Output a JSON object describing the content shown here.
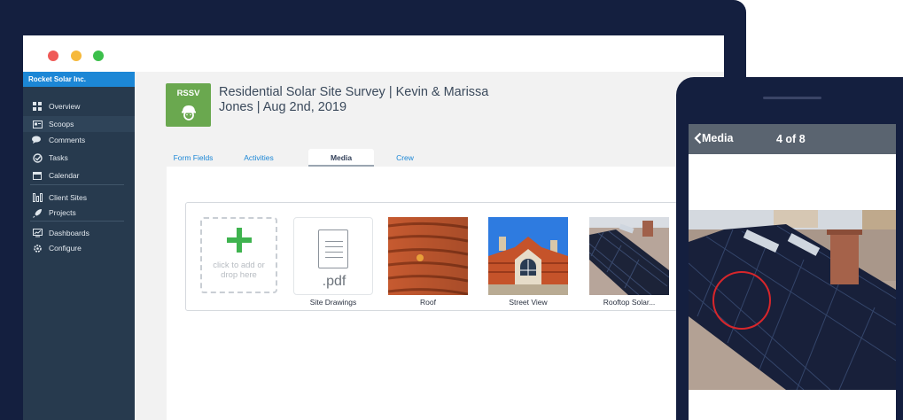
{
  "app": {
    "brand": "Rocket Solar Inc.",
    "nav": [
      {
        "label": "Overview",
        "icon": "grid-icon"
      },
      {
        "label": "Scoops",
        "icon": "scoop-card-icon"
      },
      {
        "label": "Comments",
        "icon": "comments-icon"
      },
      {
        "label": "Tasks",
        "icon": "tasks-icon"
      },
      {
        "label": "Calendar",
        "icon": "calendar-icon"
      },
      {
        "label": "Client Sites",
        "icon": "client-sites-icon"
      },
      {
        "label": "Projects",
        "icon": "rocket-icon"
      },
      {
        "label": "Dashboards",
        "icon": "dashboard-icon"
      },
      {
        "label": "Configure",
        "icon": "gear-icon"
      }
    ]
  },
  "scoop": {
    "badge": "RSSV",
    "title": "Residential Solar Site Survey | Kevin & Marissa Jones | Aug 2nd, 2019"
  },
  "tabs": [
    {
      "label": "Form Fields"
    },
    {
      "label": "Activities"
    },
    {
      "label": "Media",
      "active": true
    },
    {
      "label": "Crew"
    }
  ],
  "media": {
    "dropzone_text": "click to add or drop here",
    "items": [
      {
        "caption": "Site Drawings",
        "type": "pdf",
        "ext": ".pdf"
      },
      {
        "caption": "Roof",
        "type": "image"
      },
      {
        "caption": "Street View",
        "type": "image"
      },
      {
        "caption": "Rooftop Solar...",
        "type": "image"
      }
    ]
  },
  "phone": {
    "back_label": "Media",
    "counter": "4 of 8"
  },
  "colors": {
    "frame": "#141f3f",
    "sidebar": "#273a4e",
    "brand_bar": "#1c87d6",
    "accent_green": "#3fb34f",
    "badge_green": "#6aa84f"
  }
}
